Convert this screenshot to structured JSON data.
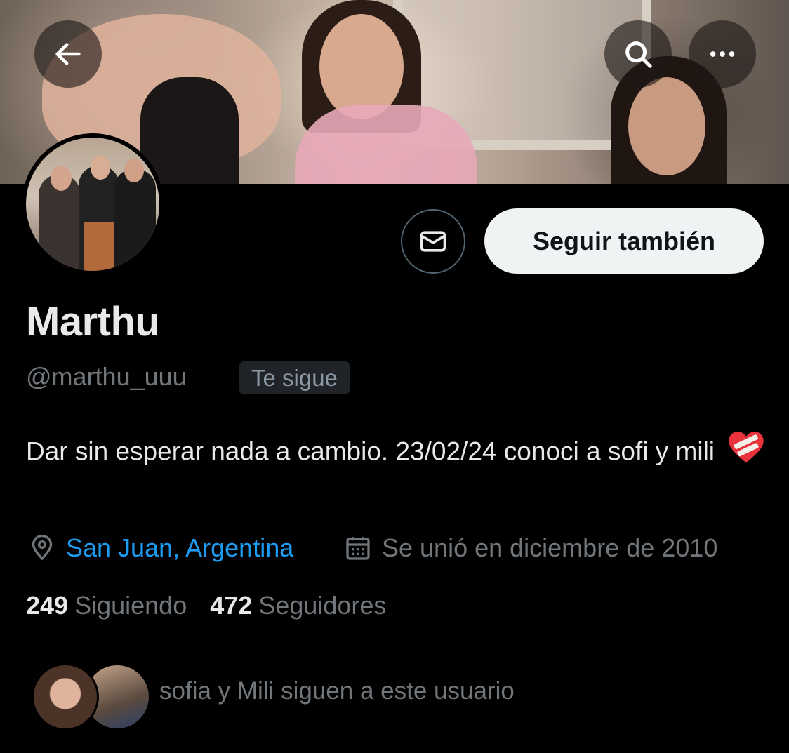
{
  "header": {
    "back_icon": "arrow-left-icon",
    "search_icon": "search-icon",
    "more_icon": "more-horizontal-icon"
  },
  "profile": {
    "name": "Marthu",
    "handle": "@marthu_uuu",
    "follows_you_badge": "Te sigue",
    "bio_text": "Dar sin esperar nada a cambio. 23/02/24 conoci a sofi y mili",
    "bio_emoji": "mending-heart",
    "location": "San Juan, Argentina",
    "joined": "Se unió en diciembre de 2010"
  },
  "actions": {
    "message_icon": "mail-icon",
    "follow_label": "Seguir también"
  },
  "stats": {
    "following_count": "249",
    "following_label": "Siguiendo",
    "followers_count": "472",
    "followers_label": "Seguidores"
  },
  "followed_by": {
    "text": "sofia y Mili siguen a este usuario"
  },
  "colors": {
    "background": "#000000",
    "link": "#1d9bf0",
    "muted": "#71767b",
    "text": "#e7e9ea",
    "button_bg": "#eff3f4"
  }
}
